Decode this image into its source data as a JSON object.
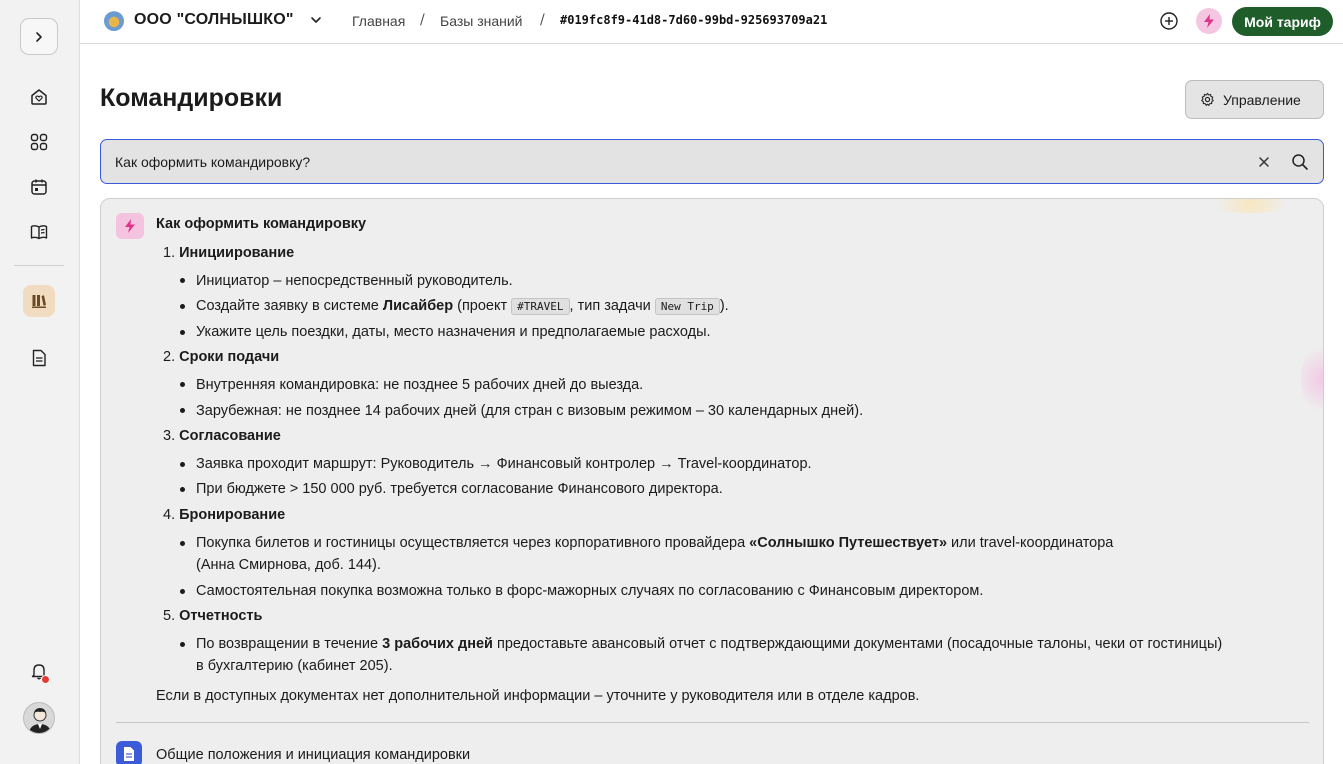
{
  "header": {
    "org_name": "ООО \"СОЛНЫШКО\"",
    "breadcrumbs": [
      "Главная",
      "Базы знаний",
      "#019fc8f9-41d8-7d60-99bd-925693709a21"
    ],
    "separator": "/",
    "tariff_label": "Мой тариф"
  },
  "sidebar": {
    "icons": [
      "chevron-right-icon",
      "home-heart-icon",
      "grid-icon",
      "calendar-icon",
      "knowledge-base-icon",
      "library-icon",
      "document-icon",
      "bell-icon"
    ],
    "active_item": "library-icon"
  },
  "page": {
    "title": "Командировки",
    "manage_label": "Управление"
  },
  "search": {
    "value": "Как оформить командировку?"
  },
  "answer": {
    "title": "Как оформить командировку",
    "sections": [
      {
        "num": "1.",
        "title": "Инициирование",
        "items": [
          "Инициатор – непосредственный руководитель.",
          "Создайте заявку в системе",
          "Укажите цель поездки, даты, место назначения и предполагаемые расходы."
        ]
      },
      {
        "num": "2.",
        "title": "Сроки подачи",
        "items": [
          "Внутренняя командировка: не позднее 5 рабочих дней до выезда.",
          "Зарубежная: не позднее 14 рабочих дней (для стран с визовым режимом – 30 календарных дней)."
        ]
      },
      {
        "num": "3.",
        "title": "Согласование",
        "items": [
          "Заявка проходит маршрут: Руководитель → Финансовый контролер → Travel-координатор.",
          "При бюджете > 150 000 руб. требуется согласование Финансового директора."
        ]
      },
      {
        "num": "4.",
        "title": "Бронирование",
        "items": [
          "Покупка билетов и гостиницы осуществляется через корпоративного провайдера",
          "Самостоятельная покупка возможна только в форс-мажорных случаях по согласованию с Финансовым директором."
        ]
      },
      {
        "num": "5.",
        "title": "Отчетность",
        "items": [
          "По возвращении в течение"
        ]
      }
    ],
    "s1_item2_bold": "Лисайбер",
    "s1_item2_mid": "(проект",
    "s1_item2_code1": "#TRAVEL",
    "s1_item2_mid2": ", тип задачи",
    "s1_item2_code2": "New Trip",
    "s1_item2_end": ").",
    "s4_item1_bold": "«Солнышко Путешествует»",
    "s4_item1_end": "или travel-координатора",
    "s4_item1_line2": "(Анна Смирнова, доб. 144).",
    "s5_item1_bold": "3 рабочих дней",
    "s5_item1_end": "предоставьте авансовый отчет с подтверждающими документами (посадочные талоны, чеки от гостиницы)",
    "s5_item1_line2": "в бухгалтерию (кабинет 205).",
    "footer_note": "Если в доступных документах нет дополнительной информации – уточните у руководителя или в отделе кадров.",
    "source_doc": "Общие положения и инициация командировки"
  }
}
